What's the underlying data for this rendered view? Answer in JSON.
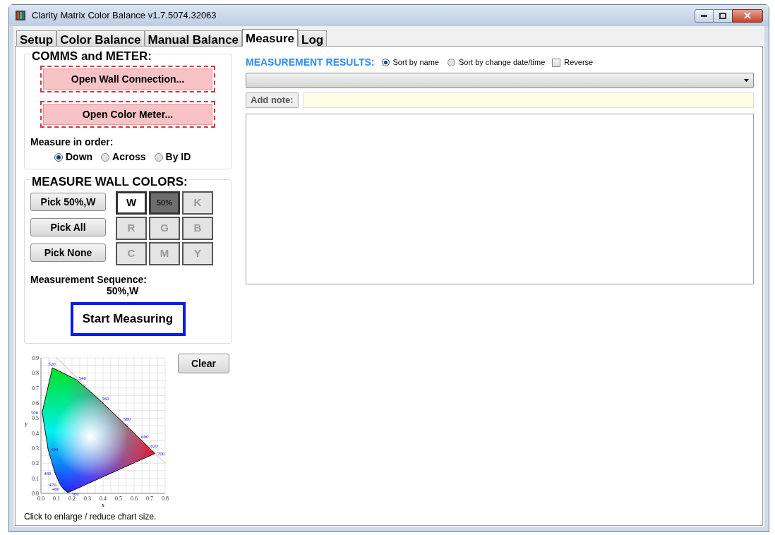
{
  "window": {
    "title": "Clarity Matrix Color Balance v1.7.5074.32063"
  },
  "tabs": [
    {
      "label": "Setup",
      "selected": false
    },
    {
      "label": "Color Balance",
      "selected": false
    },
    {
      "label": "Manual Balance",
      "selected": false
    },
    {
      "label": "Measure",
      "selected": true
    },
    {
      "label": "Log",
      "selected": false
    }
  ],
  "comms": {
    "title": "COMMS and METER:",
    "buttons": [
      "Open Wall Connection...",
      "Open Color Meter..."
    ],
    "order_label": "Measure in order:",
    "order_options": [
      {
        "label": "Down",
        "selected": true
      },
      {
        "label": "Across",
        "selected": false
      },
      {
        "label": "By ID",
        "selected": false
      }
    ]
  },
  "wall_colors": {
    "title": "MEASURE WALL COLORS:",
    "pick_buttons": [
      "Pick 50%,W",
      "Pick All",
      "Pick None"
    ],
    "cells": [
      {
        "label": "W",
        "kind": "white",
        "selected": true
      },
      {
        "label": "50%",
        "kind": "gray",
        "selected": true
      },
      {
        "label": "K",
        "kind": "color",
        "selected": false
      },
      {
        "label": "R",
        "kind": "color",
        "selected": false
      },
      {
        "label": "G",
        "kind": "color",
        "selected": false
      },
      {
        "label": "B",
        "kind": "color",
        "selected": false
      },
      {
        "label": "C",
        "kind": "color",
        "selected": false
      },
      {
        "label": "M",
        "kind": "color",
        "selected": false
      },
      {
        "label": "Y",
        "kind": "color",
        "selected": false
      }
    ],
    "sequence_label": "Measurement Sequence:",
    "sequence_value": "50%,W",
    "start_button": "Start Measuring"
  },
  "cie_chart": {
    "y_ticks": [
      "0.9",
      "0.8",
      "0.7",
      "0.6",
      "0.5",
      "0.4",
      "0.3",
      "0.2",
      "0.1",
      "0.0"
    ],
    "y_label": "y",
    "x_ticks": [
      "0.0",
      "0.1",
      "0.2",
      "0.3",
      "0.4",
      "0.5",
      "0.6",
      "0.7",
      "0.8"
    ],
    "x_label": "x",
    "wavelengths": [
      "380",
      "460",
      "470",
      "480",
      "490",
      "500",
      "520",
      "540",
      "560",
      "580",
      "600",
      "620",
      "700"
    ],
    "caption": "Click to enlarge / reduce chart size."
  },
  "clear_button": "Clear",
  "results": {
    "title": "MEASUREMENT RESULTS:",
    "sort_options": [
      {
        "label": "Sort by name",
        "selected": true
      },
      {
        "label": "Sort by change date/time",
        "selected": false
      }
    ],
    "reverse": {
      "label": "Reverse",
      "checked": false
    },
    "add_note_button": "Add note:"
  }
}
